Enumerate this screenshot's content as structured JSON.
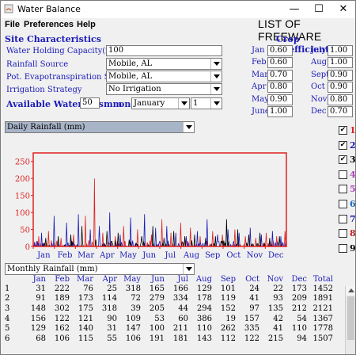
{
  "window": {
    "title": "Water Balance",
    "minimize": "—",
    "maximize": "☐",
    "close": "✕"
  },
  "menu": [
    "File",
    "Preferences",
    "Help"
  ],
  "banner": "LIST OF FREEWARE",
  "site": {
    "header": "Site Characteristics",
    "whc_label": "Water Holding Capacity(mm)",
    "whc_value": "100",
    "rain_label": "Rainfall Source",
    "rain_value": "Mobile, AL",
    "pet_label": "Pot. Evapotranspiration Source",
    "pet_value": "Mobile, AL",
    "irr_label": "Irrigation Strategy",
    "irr_value": "No Irrigation",
    "aw_label": "Available Water was",
    "aw_value": "50",
    "aw_unit": "mm",
    "aw_on": "on",
    "aw_month": "January",
    "aw_day": "1"
  },
  "crop": {
    "header": "Crop Coefficients",
    "left": [
      {
        "m": "Jan",
        "v": "0.60"
      },
      {
        "m": "Feb",
        "v": "0.60"
      },
      {
        "m": "Mar",
        "v": "0.70"
      },
      {
        "m": "Apr",
        "v": "0.80"
      },
      {
        "m": "May",
        "v": "0.90"
      },
      {
        "m": "June",
        "v": "1.00"
      }
    ],
    "right": [
      {
        "m": "July",
        "v": "1.00"
      },
      {
        "m": "Aug",
        "v": "1.00"
      },
      {
        "m": "Sept",
        "v": "0.90"
      },
      {
        "m": "Oct",
        "v": "0.90"
      },
      {
        "m": "Nov",
        "v": "0.80"
      },
      {
        "m": "Dec",
        "v": "0.70"
      }
    ]
  },
  "chart_select": "Daily Rainfall (mm)",
  "series_toggles": [
    {
      "n": "1",
      "checked": true,
      "color": "#e02020"
    },
    {
      "n": "2",
      "checked": true,
      "color": "#1a1ab8"
    },
    {
      "n": "3",
      "checked": true,
      "color": "#000000"
    },
    {
      "n": "4",
      "checked": false,
      "color": "#b040c0"
    },
    {
      "n": "5",
      "checked": false,
      "color": "#b040c0"
    },
    {
      "n": "6",
      "checked": false,
      "color": "#1a6ab8"
    },
    {
      "n": "7",
      "checked": false,
      "color": "#1a1ab8"
    },
    {
      "n": "8",
      "checked": false,
      "color": "#c02020"
    },
    {
      "n": "9",
      "checked": false,
      "color": "#000000"
    }
  ],
  "chart_data": {
    "type": "line",
    "ylim": [
      0,
      275
    ],
    "yticks": [
      "0",
      "50",
      "100",
      "150",
      "200",
      "250"
    ],
    "categories": [
      "Jan",
      "Feb",
      "Mar",
      "Apr",
      "May",
      "Jun",
      "Jul",
      "Aug",
      "Sep",
      "Oct",
      "Nov",
      "Dec"
    ],
    "series": [
      {
        "color": "#e02020",
        "spikes": [
          [
            8,
            30
          ],
          [
            22,
            45
          ],
          [
            40,
            25
          ],
          [
            58,
            35
          ],
          [
            75,
            90
          ],
          [
            88,
            200
          ],
          [
            100,
            40
          ],
          [
            118,
            30
          ],
          [
            130,
            60
          ],
          [
            150,
            50
          ],
          [
            170,
            35
          ],
          [
            185,
            80
          ],
          [
            198,
            40
          ],
          [
            212,
            70
          ],
          [
            226,
            55
          ],
          [
            240,
            30
          ],
          [
            258,
            45
          ],
          [
            272,
            35
          ],
          [
            290,
            50
          ],
          [
            305,
            30
          ],
          [
            320,
            25
          ],
          [
            335,
            40
          ],
          [
            350,
            30
          ],
          [
            362,
            45
          ]
        ]
      },
      {
        "color": "#1a1ab8",
        "spikes": [
          [
            12,
            40
          ],
          [
            30,
            90
          ],
          [
            48,
            70
          ],
          [
            65,
            95
          ],
          [
            82,
            50
          ],
          [
            95,
            60
          ],
          [
            110,
            100
          ],
          [
            125,
            35
          ],
          [
            140,
            85
          ],
          [
            160,
            95
          ],
          [
            176,
            55
          ],
          [
            192,
            60
          ],
          [
            205,
            40
          ],
          [
            220,
            30
          ],
          [
            236,
            45
          ],
          [
            250,
            80
          ],
          [
            265,
            35
          ],
          [
            280,
            50
          ],
          [
            296,
            40
          ],
          [
            312,
            55
          ],
          [
            328,
            35
          ],
          [
            344,
            45
          ],
          [
            356,
            30
          ]
        ]
      },
      {
        "color": "#000000",
        "spikes": [
          [
            18,
            25
          ],
          [
            36,
            30
          ],
          [
            54,
            35
          ],
          [
            70,
            60
          ],
          [
            90,
            20
          ],
          [
            106,
            45
          ],
          [
            122,
            40
          ],
          [
            138,
            20
          ],
          [
            156,
            30
          ],
          [
            172,
            60
          ],
          [
            188,
            25
          ],
          [
            202,
            45
          ],
          [
            218,
            30
          ],
          [
            232,
            35
          ],
          [
            248,
            25
          ],
          [
            262,
            30
          ],
          [
            278,
            80
          ],
          [
            294,
            50
          ],
          [
            310,
            35
          ],
          [
            326,
            40
          ],
          [
            340,
            25
          ],
          [
            354,
            30
          ]
        ]
      }
    ]
  },
  "monthly_select": "Monthly Rainfall (mm)",
  "monthly": {
    "headers": [
      "",
      "Jan",
      "Feb",
      "Mar",
      "Apr",
      "May",
      "Jun",
      "Jul",
      "Aug",
      "Sep",
      "Oct",
      "Nov",
      "Dec",
      "Total"
    ],
    "rows": [
      [
        "1",
        "31",
        "222",
        "76",
        "25",
        "318",
        "165",
        "166",
        "129",
        "101",
        "24",
        "22",
        "173",
        "1452"
      ],
      [
        "2",
        "91",
        "189",
        "173",
        "114",
        "72",
        "279",
        "334",
        "178",
        "119",
        "41",
        "93",
        "209",
        "1891"
      ],
      [
        "3",
        "148",
        "302",
        "175",
        "318",
        "39",
        "205",
        "44",
        "294",
        "152",
        "97",
        "135",
        "212",
        "2121"
      ],
      [
        "4",
        "156",
        "122",
        "121",
        "90",
        "109",
        "53",
        "60",
        "386",
        "19",
        "157",
        "42",
        "54",
        "1367"
      ],
      [
        "5",
        "129",
        "162",
        "140",
        "31",
        "147",
        "100",
        "211",
        "110",
        "262",
        "335",
        "41",
        "110",
        "1778"
      ],
      [
        "6",
        "68",
        "106",
        "115",
        "55",
        "106",
        "191",
        "181",
        "143",
        "112",
        "122",
        "215",
        "94",
        "1507"
      ]
    ]
  }
}
